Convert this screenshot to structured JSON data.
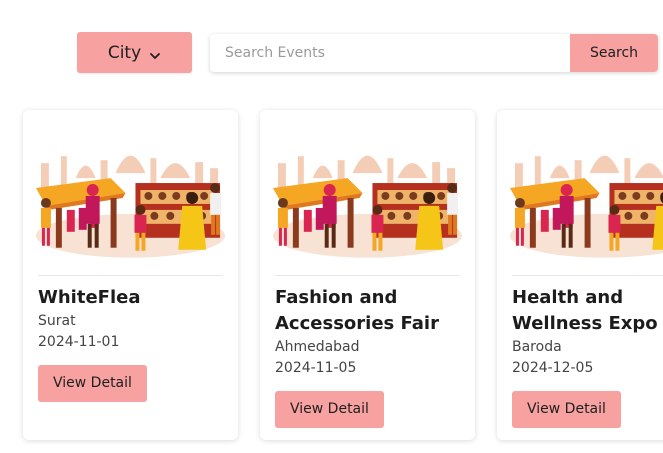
{
  "filters": {
    "city_label": "City",
    "search_placeholder": "Search Events",
    "search_button_label": "Search"
  },
  "events": [
    {
      "title": "WhiteFlea",
      "city": "Surat",
      "date": "2024-11-01",
      "button_label": "View Detail"
    },
    {
      "title": "Fashion and Accessories Fair",
      "city": "Ahmedabad",
      "date": "2024-11-05",
      "button_label": "View Detail"
    },
    {
      "title": "Health and Wellness Expo",
      "city": "Baroda",
      "date": "2024-12-05",
      "button_label": "View Detail"
    }
  ],
  "colors": {
    "accent": "#f7a1a1",
    "text": "#1c1c1c"
  },
  "icons": {
    "city_dropdown": "chevron-down-icon",
    "card_image": "market-illustration"
  }
}
